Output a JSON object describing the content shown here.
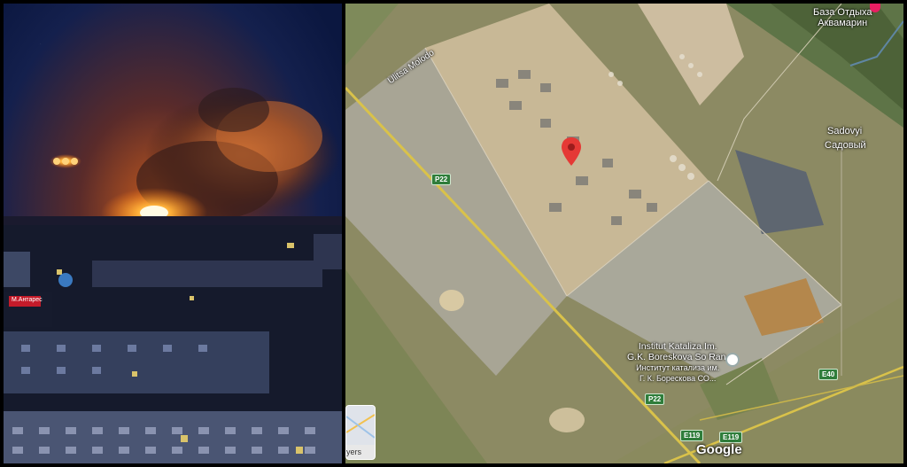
{
  "photo": {
    "description_icon": "fire-night-photo",
    "sign_text": "M.Антарес"
  },
  "map": {
    "labels": {
      "resort_ru_line1": "База Отдыха",
      "resort_ru_line2": "Аквамарин",
      "street": "Ulitsa Molodo",
      "sadovyi_en": "Sadovyi",
      "sadovyi_ru": "Садовый",
      "institute_en_line1": "Institut Kataliza Im.",
      "institute_en_line2": "G.K. Boreskova So Ran.",
      "institute_ru_line1": "Институт катализа им.",
      "institute_ru_line2": "Г. К. Борескова СО..."
    },
    "roads": {
      "p22_a": "P22",
      "p22_b": "P22",
      "e40": "E40",
      "e119_a": "E119",
      "e119_b": "E119"
    },
    "layers_label": "yers",
    "google_logo": "Google",
    "colors": {
      "pin": "#e53935",
      "road": "#d9c24a",
      "shield": "#2f7d3b"
    }
  }
}
